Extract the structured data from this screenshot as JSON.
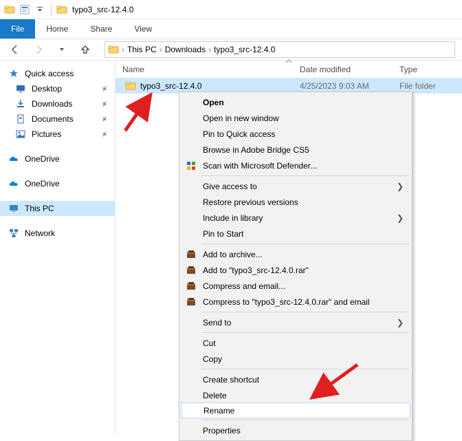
{
  "window": {
    "title": "typo3_src-12.4.0"
  },
  "ribbon": {
    "file": "File",
    "tabs": [
      "Home",
      "Share",
      "View"
    ]
  },
  "nav": {
    "back_enabled": true,
    "forward_enabled": false
  },
  "breadcrumb": {
    "segments": [
      "This PC",
      "Downloads",
      "typo3_src-12.4.0"
    ]
  },
  "navpane": {
    "quick_access": {
      "label": "Quick access",
      "items": [
        {
          "label": "Desktop",
          "pinned": true
        },
        {
          "label": "Downloads",
          "pinned": true
        },
        {
          "label": "Documents",
          "pinned": true
        },
        {
          "label": "Pictures",
          "pinned": true
        }
      ]
    },
    "onedrive1": {
      "label": "OneDrive"
    },
    "onedrive2": {
      "label": "OneDrive"
    },
    "thispc": {
      "label": "This PC"
    },
    "network": {
      "label": "Network"
    }
  },
  "columns": {
    "name": "Name",
    "date": "Date modified",
    "type": "Type"
  },
  "rows": [
    {
      "name": "typo3_src-12.4.0",
      "date": "4/25/2023 9:03 AM",
      "type": "File folder",
      "selected": true
    }
  ],
  "context_menu": {
    "open": "Open",
    "open_new_window": "Open in new window",
    "pin_quick": "Pin to Quick access",
    "browse_bridge": "Browse in Adobe Bridge CS5",
    "scan_defender": "Scan with Microsoft Defender...",
    "give_access": "Give access to",
    "restore_prev": "Restore previous versions",
    "include_lib": "Include in library",
    "pin_start": "Pin to Start",
    "add_archive": "Add to archive...",
    "add_rar": "Add to \"typo3_src-12.4.0.rar\"",
    "compress_email": "Compress and email...",
    "compress_rar_email": "Compress to \"typo3_src-12.4.0.rar\" and email",
    "send_to": "Send to",
    "cut": "Cut",
    "copy": "Copy",
    "create_shortcut": "Create shortcut",
    "delete": "Delete",
    "rename": "Rename",
    "properties": "Properties"
  }
}
